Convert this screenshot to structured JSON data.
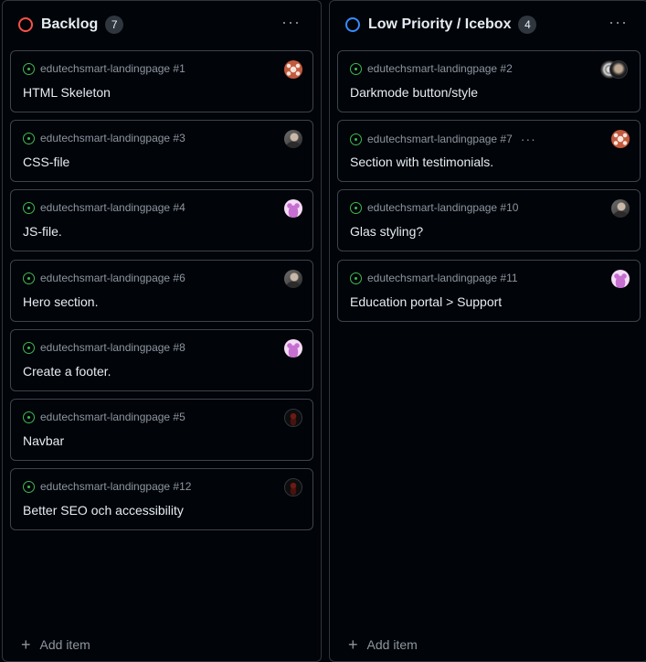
{
  "columns": [
    {
      "title": "Backlog",
      "count": "7",
      "status_color": "#f85149",
      "menu_label": "···",
      "add_item_label": "Add item",
      "cards": [
        {
          "meta": "edutechsmart-landingpage #1",
          "title": "HTML Skeleton",
          "avatar": "orange-pattern-avatar"
        },
        {
          "meta": "edutechsmart-landingpage #3",
          "title": "CSS-file",
          "avatar": "photo-avatar"
        },
        {
          "meta": "edutechsmart-landingpage #4",
          "title": "JS-file.",
          "avatar": "pink-pattern-avatar"
        },
        {
          "meta": "edutechsmart-landingpage #6",
          "title": "Hero section.",
          "avatar": "photo-avatar"
        },
        {
          "meta": "edutechsmart-landingpage #8",
          "title": "Create a footer.",
          "avatar": "pink-pattern-avatar"
        },
        {
          "meta": "edutechsmart-landingpage #5",
          "title": "Navbar",
          "avatar": "dark-avatar"
        },
        {
          "meta": "edutechsmart-landingpage #12",
          "title": "Better SEO och accessibility",
          "avatar": "dark-avatar"
        }
      ]
    },
    {
      "title": "Low Priority / Icebox",
      "count": "4",
      "status_color": "#388bfd",
      "menu_label": "···",
      "add_item_label": "Add item",
      "cards": [
        {
          "meta": "edutechsmart-landingpage #2",
          "title": "Darkmode button/style",
          "avatar": "avatar-group"
        },
        {
          "meta": "edutechsmart-landingpage #7",
          "title": "Section with testimonials.",
          "avatar": "orange-pattern-avatar",
          "show_dots": true
        },
        {
          "meta": "edutechsmart-landingpage #10",
          "title": "Glas styling?",
          "avatar": "photo-avatar"
        },
        {
          "meta": "edutechsmart-landingpage #11",
          "title": "Education portal > Support",
          "avatar": "pink-pattern-avatar"
        }
      ]
    }
  ],
  "card_menu_label": "···",
  "add_icon": "+"
}
